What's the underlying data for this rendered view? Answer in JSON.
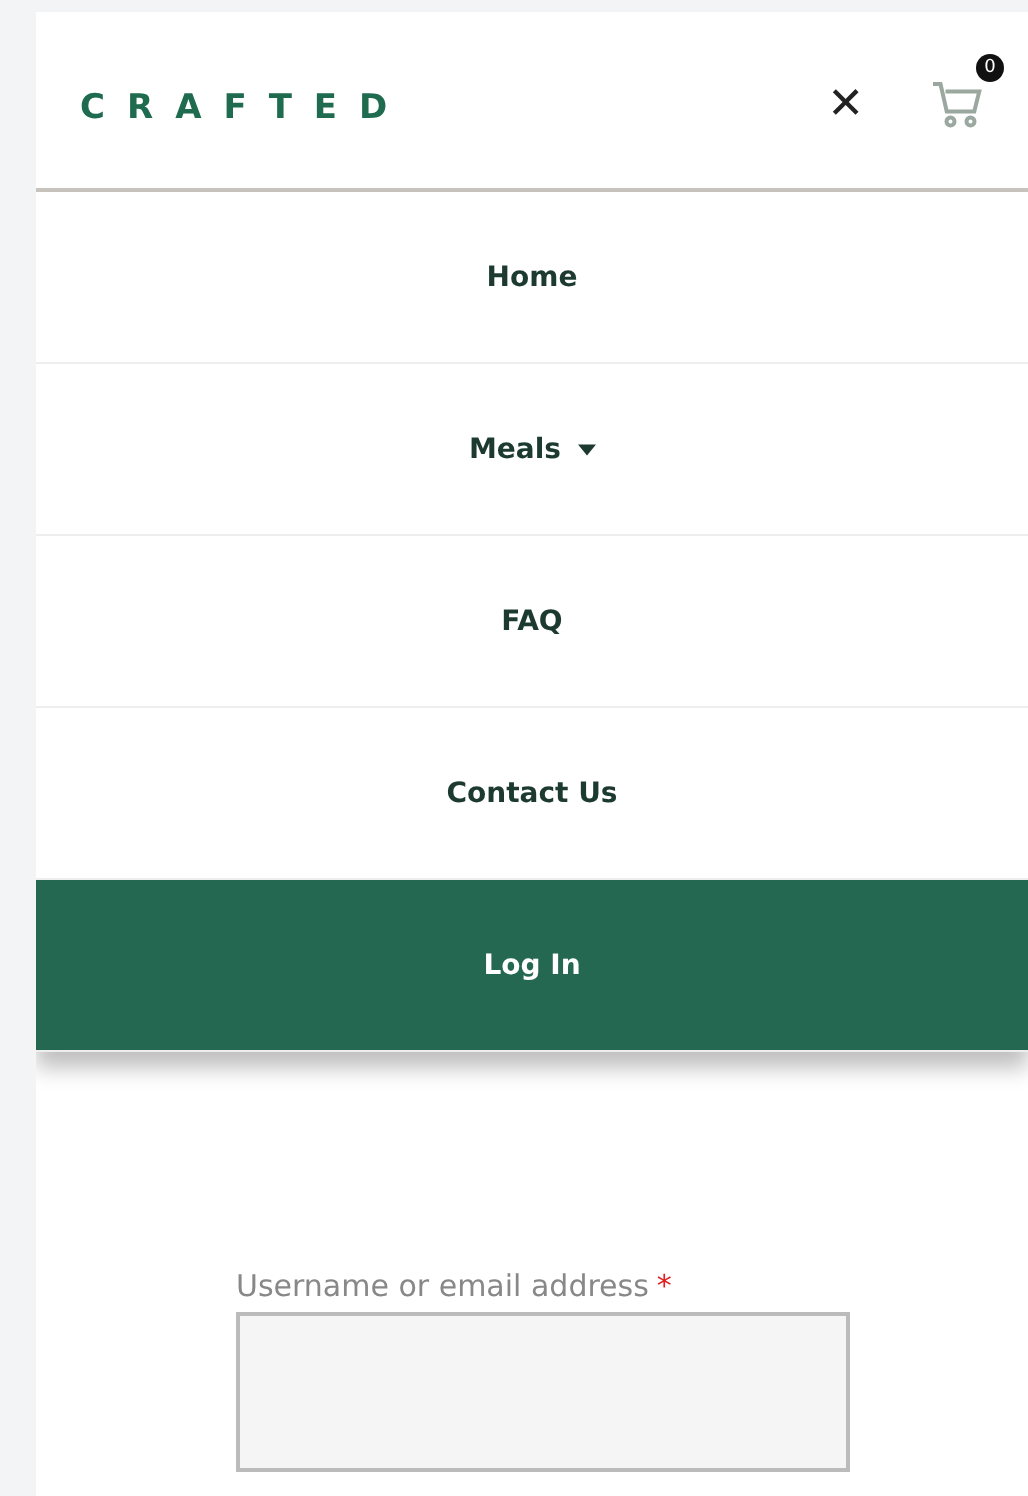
{
  "header": {
    "logo": "CRAFTED",
    "close_icon": "✕",
    "cart_count": "0"
  },
  "menu": [
    {
      "label": "Home",
      "kind": "link",
      "has_dropdown": false
    },
    {
      "label": "Meals",
      "kind": "link",
      "has_dropdown": true
    },
    {
      "label": "FAQ",
      "kind": "link",
      "has_dropdown": false
    },
    {
      "label": "Contact Us",
      "kind": "link",
      "has_dropdown": false
    },
    {
      "label": "Log In",
      "kind": "primary",
      "has_dropdown": false
    }
  ],
  "form": {
    "fields": [
      {
        "label": "Username or email address",
        "required_mark": "*"
      }
    ]
  }
}
